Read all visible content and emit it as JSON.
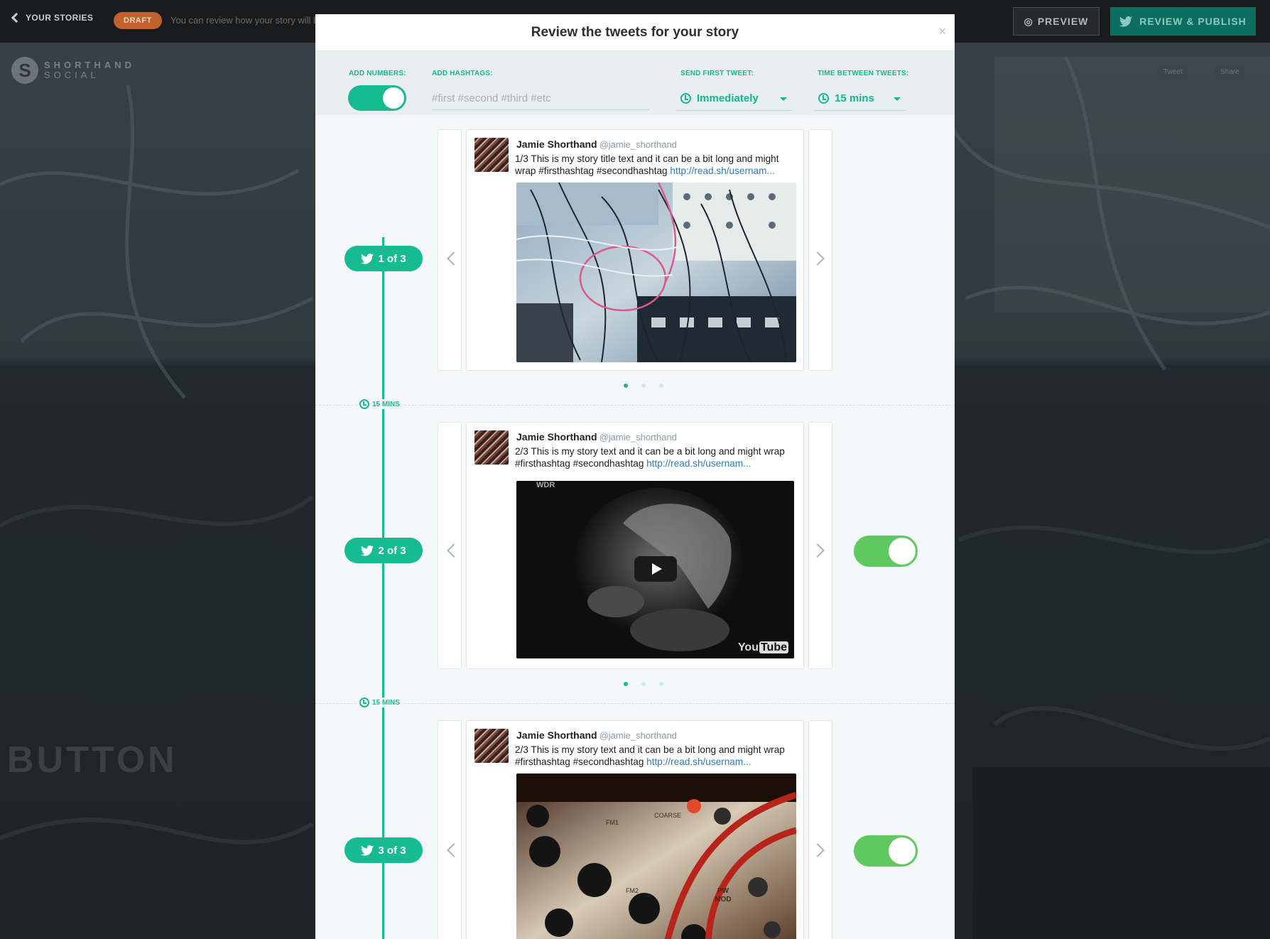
{
  "topbar": {
    "back_label": "YOUR STORIES",
    "draft_badge": "DRAFT",
    "draft_message": "You can review how your story will be tweeted before publishing",
    "preview_label": "PREVIEW",
    "publish_label": "REVIEW & PUBLISH"
  },
  "logo": {
    "letter": "S",
    "line1": "SHORTHAND",
    "line2": "SOCIAL"
  },
  "share_buttons": {
    "tweet": "Tweet",
    "share": "Share"
  },
  "background_text": "BUTTON",
  "modal": {
    "title": "Review the tweets for your story",
    "close": "×",
    "settings": {
      "add_numbers_label": "ADD NUMBERS:",
      "add_numbers_on": true,
      "hashtags_label": "ADD HASHTAGS:",
      "hashtags_placeholder": "#first #second #third #etc",
      "send_first_label": "SEND FIRST TWEET:",
      "send_first_value": "Immediately",
      "time_between_label": "TIME BETWEEN TWEETS:",
      "time_between_value": "15 mins"
    },
    "interval_label": "15 MINS",
    "tweets": [
      {
        "badge": "1 of 3",
        "name": "Jamie Shorthand",
        "handle": "@jamie_shorthand",
        "text": "1/3 This is my story title text and it can be a bit long and might wrap #firsthashtag #secondhashtag",
        "link": "http://read.sh/usernam...",
        "media": "photo-modular-synth-cables",
        "carousel_dots": 3,
        "carousel_active": 0,
        "enabled_toggle": false
      },
      {
        "badge": "2 of 3",
        "name": "Jamie Shorthand",
        "handle": "@jamie_shorthand",
        "text": "2/3 This is my story text and it can be a bit long and might wrap #firsthashtag #secondhashtag",
        "link": "http://read.sh/usernam...",
        "media": "youtube-video",
        "video_watermark": "WDR",
        "video_logo_1": "You",
        "video_logo_2": "Tube",
        "carousel_dots": 3,
        "carousel_active": 0,
        "enabled_toggle": true
      },
      {
        "badge": "3 of 3",
        "name": "Jamie Shorthand",
        "handle": "@jamie_shorthand",
        "text": "2/3 This is my story text and it can be a bit long and might wrap #firsthashtag #secondhashtag",
        "link": "http://read.sh/usernam...",
        "media": "photo-synth-panel-knobs",
        "panel_labels": [
          "FM1",
          "COARSE",
          "FM2",
          "PW MOD"
        ],
        "enabled_toggle": true
      }
    ]
  },
  "colors": {
    "accent": "#16bb91",
    "toggle_green": "#5fc860",
    "link": "#2b7bb9",
    "draft": "#c1622c"
  }
}
